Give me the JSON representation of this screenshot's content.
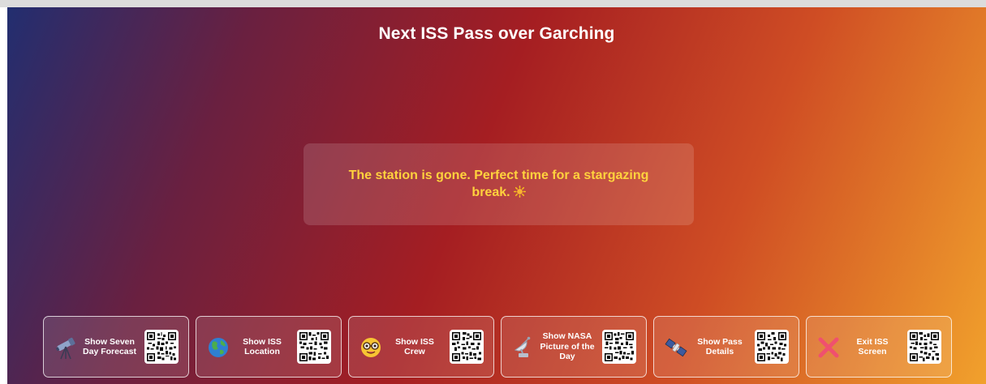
{
  "screen": {
    "title": "Next ISS Pass over Garching",
    "message": "The station is gone. Perfect time for a stargazing break."
  },
  "colors": {
    "gradient_start": "#222e70",
    "gradient_mid": "#a51e22",
    "gradient_end": "#f1a12c",
    "message_text": "#ffd23d"
  },
  "actions": [
    {
      "label": "Show Seven Day Forecast",
      "icon": "telescope-icon"
    },
    {
      "label": "Show ISS Location",
      "icon": "globe-icon"
    },
    {
      "label": "Show ISS Crew",
      "icon": "nerd-face-icon"
    },
    {
      "label": "Show NASA Picture of the Day",
      "icon": "satellite-antenna-icon"
    },
    {
      "label": "Show Pass Details",
      "icon": "satellite-icon"
    },
    {
      "label": "Exit ISS Screen",
      "icon": "cross-mark-icon"
    }
  ]
}
